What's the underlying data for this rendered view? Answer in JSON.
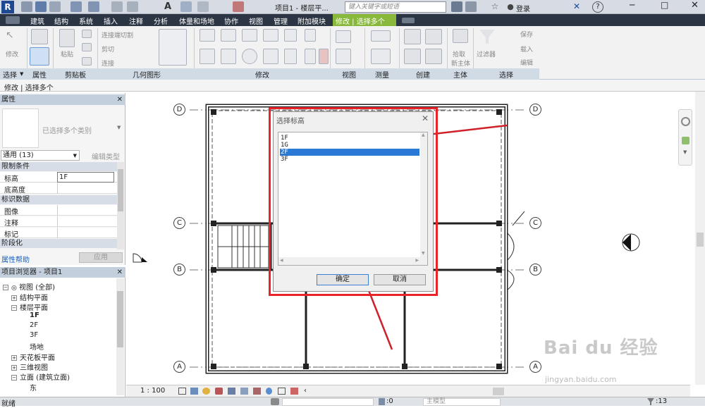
{
  "window": {
    "title": "项目1 - 楼层平...",
    "search_placeholder": "键入关键字或短语",
    "login": "登录",
    "help": "?"
  },
  "menu_tabs": [
    "建筑",
    "结构",
    "系统",
    "插入",
    "注释",
    "分析",
    "体量和场地",
    "协作",
    "视图",
    "管理",
    "附加模块",
    "修改 | 选择多个"
  ],
  "ribbon": {
    "modify": "修改",
    "paste": "粘贴",
    "cut_label": "连接端切割",
    "cut": "剪切",
    "join": "连接",
    "pick_new_host": [
      "拾取",
      "新主体"
    ],
    "filter": "过滤器",
    "save": "保存",
    "load": "载入",
    "edit": "编辑",
    "panels": [
      "选择",
      "属性",
      "剪贴板",
      "几何图形",
      "修改",
      "视图",
      "测量",
      "创建",
      "主体",
      "选择"
    ]
  },
  "context_label": "修改 | 选择多个",
  "properties": {
    "header": "属性",
    "type_selector": "已选择多个类别",
    "filter_value": "通用 (13)",
    "edit_type": "编辑类型",
    "sections": [
      {
        "title": "限制条件",
        "rows": [
          {
            "key": "标高",
            "value": "1F"
          },
          {
            "key": "底高度",
            "value": ""
          }
        ]
      },
      {
        "title": "标识数据",
        "rows": [
          {
            "key": "图像",
            "value": ""
          },
          {
            "key": "注释",
            "value": ""
          },
          {
            "key": "标记",
            "value": ""
          }
        ]
      },
      {
        "title": "阶段化",
        "rows": []
      }
    ],
    "help_link": "属性帮助",
    "apply": "应用"
  },
  "browser": {
    "header": "项目浏览器 - 项目1",
    "items": [
      {
        "label": "视图 (全部)",
        "toggle": "−"
      },
      {
        "label": "结构平面",
        "toggle": "+"
      },
      {
        "label": "楼层平面",
        "toggle": "−"
      },
      {
        "label": "1F",
        "toggle": ""
      },
      {
        "label": "2F",
        "toggle": ""
      },
      {
        "label": "3F",
        "toggle": ""
      },
      {
        "label": "场地",
        "toggle": ""
      },
      {
        "label": "天花板平面",
        "toggle": "+"
      },
      {
        "label": "三维视图",
        "toggle": "+"
      },
      {
        "label": "立面 (建筑立面)",
        "toggle": "−"
      },
      {
        "label": "东",
        "toggle": ""
      }
    ]
  },
  "dialog": {
    "title": "选择标高",
    "levels": [
      "1F",
      "1G",
      "2F",
      "3F"
    ],
    "selected": "2F",
    "ok": "确定",
    "cancel": "取消"
  },
  "grid_labels": {
    "top": "D",
    "mid": "C",
    "b": "B",
    "bottom": "A"
  },
  "view_bar": {
    "scale": "1 : 100"
  },
  "status": {
    "ready": "就绪",
    "count_zero": ":0",
    "main_model": "主模型",
    "selection_count": ":13"
  },
  "watermark": {
    "brand": "Bai du 经验",
    "url": "jingyan.baidu.com"
  },
  "colors": {
    "accent_blue": "#2a7ad5",
    "highlight_red": "#e8242a",
    "menu_bg": "#2c3543"
  }
}
